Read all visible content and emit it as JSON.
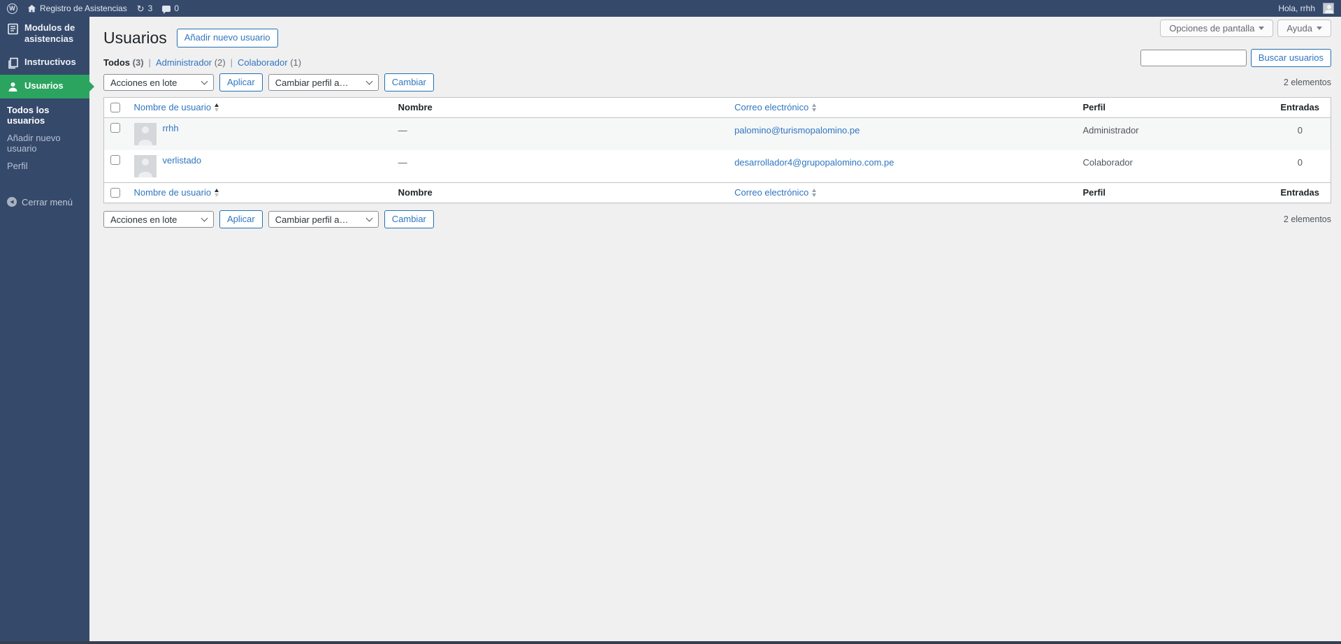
{
  "admin_bar": {
    "site_name": "Registro de Asistencias",
    "updates_count": "3",
    "comments_count": "0",
    "greeting": "Hola, rrhh"
  },
  "sidebar": {
    "items": [
      {
        "label": "Modulos de asistencias"
      },
      {
        "label": "Instructivos"
      },
      {
        "label": "Usuarios"
      }
    ],
    "submenu": [
      {
        "label": "Todos los usuarios"
      },
      {
        "label": "Añadir nuevo usuario"
      },
      {
        "label": "Perfil"
      }
    ],
    "collapse_label": "Cerrar menú"
  },
  "screen_meta": {
    "screen_options_label": "Opciones de pantalla",
    "help_label": "Ayuda"
  },
  "page": {
    "title": "Usuarios",
    "add_new_label": "Añadir nuevo usuario"
  },
  "views": {
    "separator": "|",
    "items": [
      {
        "label": "Todos",
        "count": "(3)",
        "current": true
      },
      {
        "label": "Administrador",
        "count": "(2)",
        "current": false
      },
      {
        "label": "Colaborador",
        "count": "(1)",
        "current": false
      }
    ]
  },
  "toolbar": {
    "bulk_actions_value": "Acciones en lote",
    "apply_label": "Aplicar",
    "change_role_value": "Cambiar perfil a…",
    "change_label": "Cambiar",
    "items_count": "2 elementos"
  },
  "search": {
    "value": "",
    "button_label": "Buscar usuarios"
  },
  "table": {
    "columns": {
      "username": "Nombre de usuario",
      "name": "Nombre",
      "email": "Correo electrónico",
      "role": "Perfil",
      "posts": "Entradas"
    },
    "rows": [
      {
        "username": "rrhh",
        "name": "—",
        "email": "palomino@turismopalomino.pe",
        "role": "Administrador",
        "posts": "0"
      },
      {
        "username": "verlistado",
        "name": "—",
        "email": "desarrollador4@grupopalomino.com.pe",
        "role": "Colaborador",
        "posts": "0"
      }
    ]
  },
  "colors": {
    "admin_bar": "#35496b",
    "menu_active": "#2ba45f",
    "link": "#2f76c0",
    "button_border": "#2271b1"
  }
}
